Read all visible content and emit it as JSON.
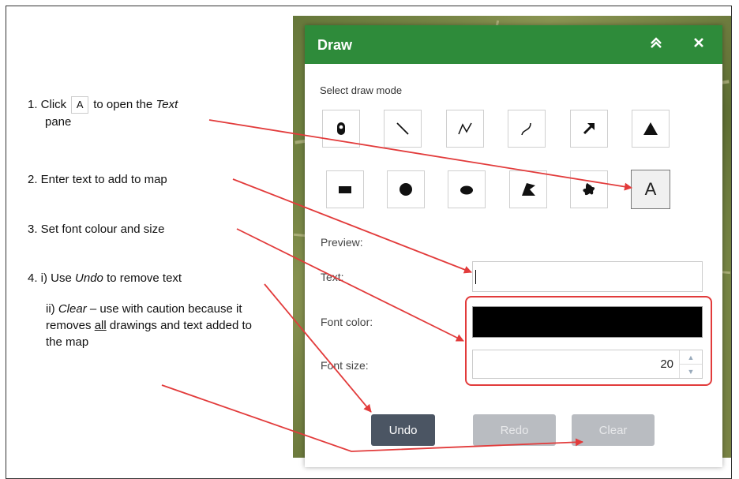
{
  "panel": {
    "title": "Draw",
    "collapse_icon": "double-chevron-up-icon",
    "close_icon": "close-icon",
    "mode_label": "Select draw mode",
    "tools": [
      {
        "name": "point-tool",
        "icon": "map-pin-icon"
      },
      {
        "name": "line-tool",
        "icon": "line-icon"
      },
      {
        "name": "polyline-tool",
        "icon": "polyline-icon"
      },
      {
        "name": "freehand-line-tool",
        "icon": "freehand-line-icon"
      },
      {
        "name": "arrow-tool",
        "icon": "arrow-icon"
      },
      {
        "name": "triangle-tool",
        "icon": "triangle-icon"
      },
      {
        "name": "rectangle-tool",
        "icon": "rectangle-icon"
      },
      {
        "name": "circle-tool",
        "icon": "circle-icon"
      },
      {
        "name": "ellipse-tool",
        "icon": "ellipse-icon"
      },
      {
        "name": "polygon-tool",
        "icon": "polygon-icon"
      },
      {
        "name": "freehand-polygon-tool",
        "icon": "freehand-polygon-icon"
      },
      {
        "name": "text-tool",
        "icon": "text-icon",
        "glyph": "A",
        "active": true
      }
    ],
    "preview_label": "Preview:",
    "text_label": "Text:",
    "text_value": "",
    "font_color_label": "Font color:",
    "font_color_value": "#000000",
    "font_size_label": "Font size:",
    "font_size_value": "20",
    "undo_label": "Undo",
    "redo_label": "Redo",
    "clear_label": "Clear"
  },
  "instructions": {
    "step1_prefix": "1. Click",
    "step1_glyph": "A",
    "step1_mid": "to open the",
    "step1_emph": "Text",
    "step1_suffix": "pane",
    "step2": "2. Enter text to add to map",
    "step3": "3. Set font colour and size",
    "step4_prefix": "4.  i)  Use",
    "step4_emph": "Undo",
    "step4_suffix": "to remove text",
    "step4b_prefix": "ii)",
    "step4b_emph": "Clear",
    "step4b_mid": "– use with caution because it removes",
    "step4b_underline": "all",
    "step4b_suffix": "drawings and text added to the map"
  },
  "colors": {
    "header": "#2e8b3a",
    "annotation": "#e23b3b",
    "undo_button": "#4b5563",
    "disabled_button": "#b9bcc1"
  }
}
